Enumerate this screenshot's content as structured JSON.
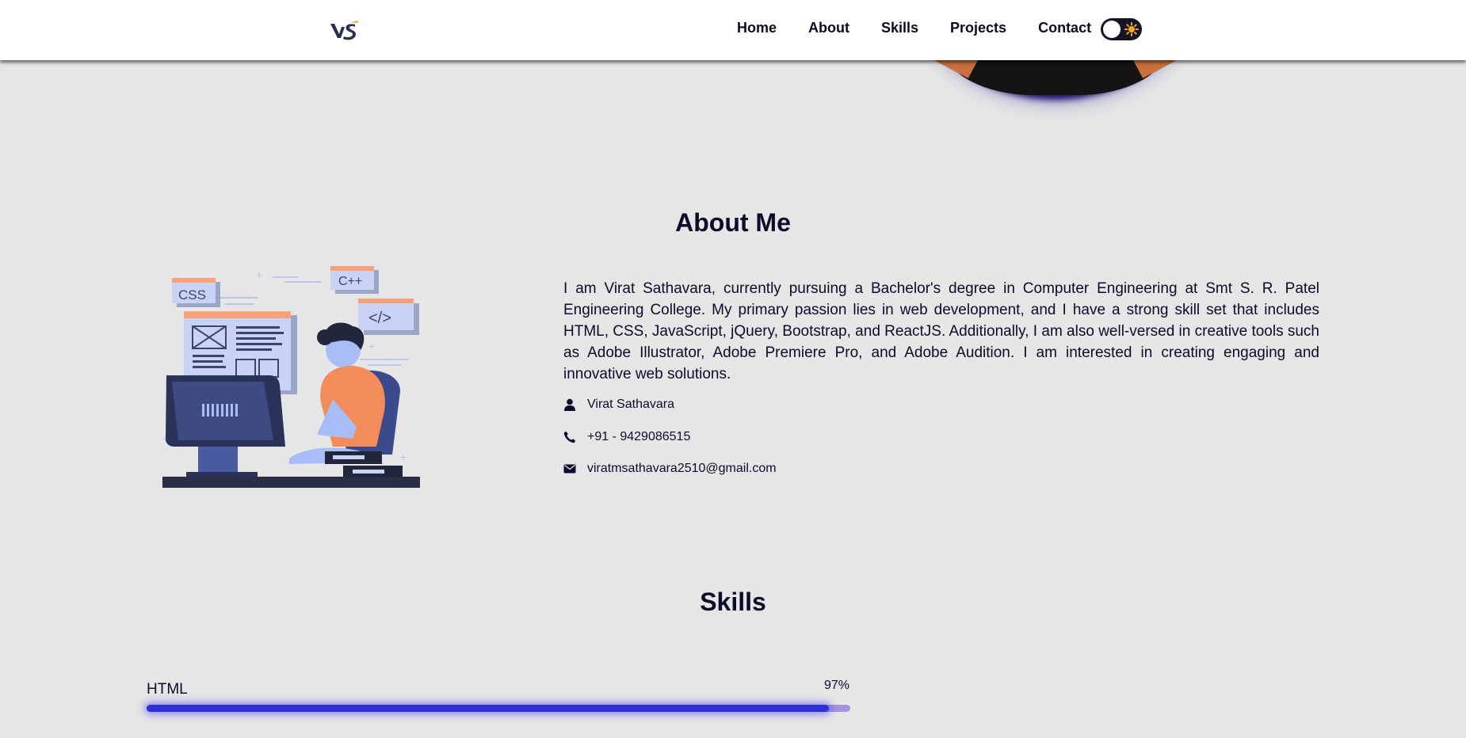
{
  "header": {
    "logo_text": "VS",
    "nav": [
      "Home",
      "About",
      "Skills",
      "Projects",
      "Contact"
    ]
  },
  "about": {
    "title": "About Me",
    "illustration_labels": [
      "CSS",
      "C++",
      "</>"
    ],
    "bio": "I am Virat Sathavara, currently pursuing a Bachelor's degree in Computer Engineering at Smt S. R. Patel Engineering College. My primary passion lies in web development, and I have a strong skill set that includes HTML, CSS, JavaScript, jQuery, Bootstrap, and ReactJS. Additionally, I am also well-versed in creative tools such as Adobe Illustrator, Adobe Premiere Pro, and Adobe Audition. I am interested in creating engaging and innovative web solutions.",
    "name": "Virat Sathavara",
    "phone": "+91 - 9429086515",
    "email": "viratmsathavara2510@gmail.com"
  },
  "skills": {
    "title": "Skills",
    "items": [
      {
        "name": "HTML",
        "percent_label": "97%",
        "percent": 97
      }
    ]
  },
  "colors": {
    "accent": "#2f2fd6",
    "track": "#a592e0",
    "text": "#0b0b2a",
    "background": "#e6e6e6"
  },
  "icons": [
    "user-icon",
    "phone-icon",
    "envelope-icon",
    "sun-icon"
  ]
}
